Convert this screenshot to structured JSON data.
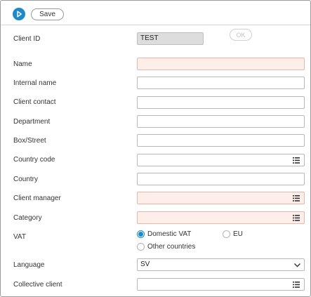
{
  "toolbar": {
    "save_label": "Save",
    "run_icon": "play-icon"
  },
  "client_id": {
    "label": "Client ID",
    "value": "TEST",
    "ok_label": "OK"
  },
  "fields": {
    "name": {
      "label": "Name",
      "value": ""
    },
    "internal_name": {
      "label": "Internal name",
      "value": ""
    },
    "client_contact": {
      "label": "Client contact",
      "value": ""
    },
    "department": {
      "label": "Department",
      "value": ""
    },
    "box_street": {
      "label": "Box/Street",
      "value": ""
    },
    "country_code": {
      "label": "Country code",
      "value": ""
    },
    "country": {
      "label": "Country",
      "value": ""
    },
    "client_manager": {
      "label": "Client manager",
      "value": ""
    },
    "category": {
      "label": "Category",
      "value": ""
    },
    "language": {
      "label": "Language",
      "value": "SV"
    },
    "collective_client": {
      "label": "Collective client",
      "value": ""
    }
  },
  "vat": {
    "label": "VAT",
    "options": [
      "Domestic VAT",
      "EU",
      "Other countries"
    ],
    "selected": "Domestic VAT"
  },
  "colors": {
    "accent": "#1e88c9",
    "required_bg": "#fdeeea",
    "readonly_bg": "#dddddd"
  }
}
